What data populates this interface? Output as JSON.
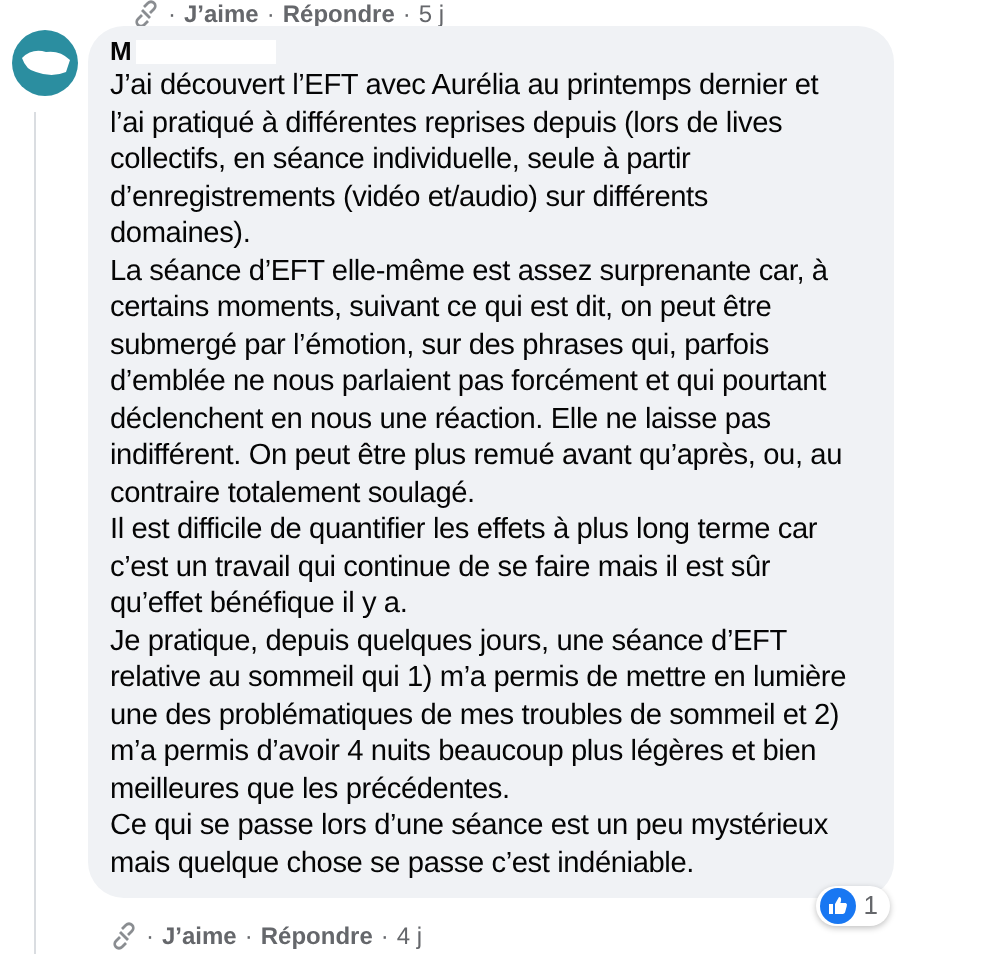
{
  "previous_comment_actions": {
    "separator_1": "·",
    "like": "J’aime",
    "separator_2": "·",
    "reply": "Répondre",
    "separator_3": "·",
    "time": "5 j"
  },
  "comment": {
    "author": "M",
    "author_redacted": true,
    "paragraphs": [
      "J’ai découvert l’EFT avec Aurélia au printemps dernier et l’ai pratiqué à différentes reprises depuis (lors de lives collectifs, en séance individuelle, seule à partir d’enregistrements (vidéo et/audio) sur différents domaines).",
      "La séance d’EFT elle-même est assez surprenante car, à certains moments, suivant ce qui est dit, on peut être submergé par l’émotion, sur des phrases qui, parfois d’emblée ne nous parlaient pas forcément et qui pourtant déclenchent en nous une réaction. Elle ne laisse pas indifférent. On peut être plus remué avant qu’après, ou, au contraire totalement soulagé.",
      "Il est difficile de quantifier les effets à plus long terme car c’est un travail qui continue de se faire mais il est sûr qu’effet bénéfique il y a.",
      "Je pratique, depuis quelques jours, une séance d’EFT relative au sommeil qui 1) m’a permis de mettre en lumière une des problématiques de mes troubles de sommeil et 2) m’a permis d’avoir 4 nuits beaucoup plus légères et bien meilleures que les précédentes.",
      "Ce qui se passe lors d’une séance est un peu mystérieux mais quelque chose se passe c’est indéniable."
    ],
    "reactions": "1",
    "actions": {
      "separator_1": "·",
      "like": "J’aime",
      "separator_2": "·",
      "reply": "Répondre",
      "separator_3": "·",
      "time": "4 j"
    }
  }
}
